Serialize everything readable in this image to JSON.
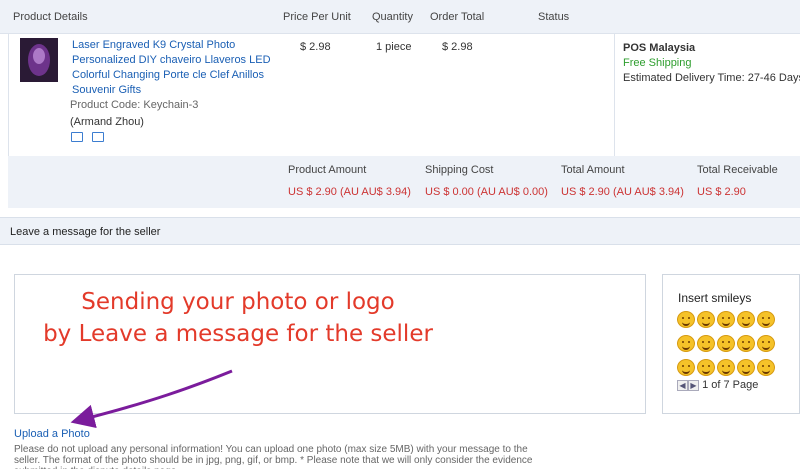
{
  "table_header": {
    "product_details": "Product Details",
    "price_per_unit": "Price Per Unit",
    "quantity": "Quantity",
    "order_total": "Order Total",
    "status": "Status"
  },
  "product": {
    "name": "Laser Engraved K9 Crystal Photo Personalized DIY chaveiro Llaveros LED Colorful Changing Porte cle Clef Anillos Souvenir Gifts",
    "code": "Product Code: Keychain-3",
    "seller": "(Armand Zhou)",
    "price": "$ 2.98",
    "quantity": "1 piece",
    "total": "$ 2.98",
    "shipping": {
      "carrier": "POS Malaysia",
      "free": "Free Shipping",
      "delivery": "Estimated Delivery Time: 27-46 Days"
    },
    "icons": [
      "shipping-icon",
      "card-icon"
    ]
  },
  "summary": {
    "product_amount_label": "Product Amount",
    "product_amount_value": "US $ 2.90 (AU AU$ 3.94)",
    "shipping_cost_label": "Shipping Cost",
    "shipping_cost_value": "US $ 0.00 (AU AU$ 0.00)",
    "total_amount_label": "Total Amount",
    "total_amount_value": "US $ 2.90 (AU AU$ 3.94)",
    "total_receivable_label": "Total Receivable",
    "total_receivable_value": "US $ 2.90"
  },
  "message": {
    "section_title": "Leave a message for the seller",
    "overlay_line1": "Sending your photo or logo",
    "overlay_line2": "by Leave a message for the seller",
    "upload_link": "Upload a Photo",
    "note": "Please do not upload any personal information! You can upload one photo (max size 5MB) with your message to the seller. The format of the photo should be in jpg, png, gif, or bmp. * Please note that we will only consider the evidence submitted in the dispute details page."
  },
  "smileys": {
    "title": "Insert smileys",
    "page_info": "1 of 7 Page",
    "count": 15
  },
  "colors": {
    "link": "#1a5fb4",
    "price_red": "#cc3333",
    "free_green": "#2e9e2e",
    "overlay_red": "#e33a2a",
    "arrow_purple": "#7b1c9c"
  }
}
